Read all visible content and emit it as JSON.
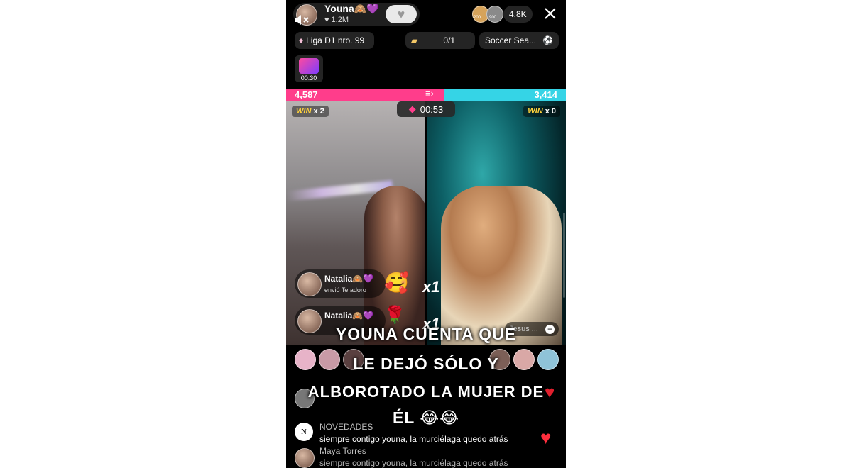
{
  "host": {
    "name": "Youna🙈💜",
    "likes": "1.2M"
  },
  "viewers": {
    "count": "4.8K",
    "badge_left": "200",
    "badge_right": "900"
  },
  "pills": {
    "league": "Liga D1 nro. 99",
    "goal": "0/1",
    "event": "Soccer Sea..."
  },
  "gift_timer": "00:30",
  "battle": {
    "left_score": "4,587",
    "right_score": "3,414",
    "timer": "00:53",
    "left_win": "WIN",
    "left_mult": "x 2",
    "right_win": "WIN",
    "right_mult": "x 0",
    "left_color": "#ff3d8b",
    "right_color": "#35d4e6"
  },
  "gifts": [
    {
      "user": "Natalia🙈💜",
      "action": "envió Te adoro",
      "multiplier": "x1"
    },
    {
      "user": "Natalia🙈💜",
      "multiplier": "x1"
    }
  ],
  "chip_guest": "Jesus ...",
  "caption": [
    "YOUNA CUENTA QUE",
    "LE DEJÓ SÓLO Y",
    "ALBOROTADO LA MUJER DE",
    "ÉL 😂😂"
  ],
  "emoji_row": "😂😂😂😂",
  "comments": [
    {
      "user": "NOVEDADES",
      "text": "siempre contigo youna, la murciélaga quedo atrás"
    },
    {
      "user": "Maya Torres",
      "text": "siempre contigo youna, la murciélaga quedo atrás"
    }
  ]
}
